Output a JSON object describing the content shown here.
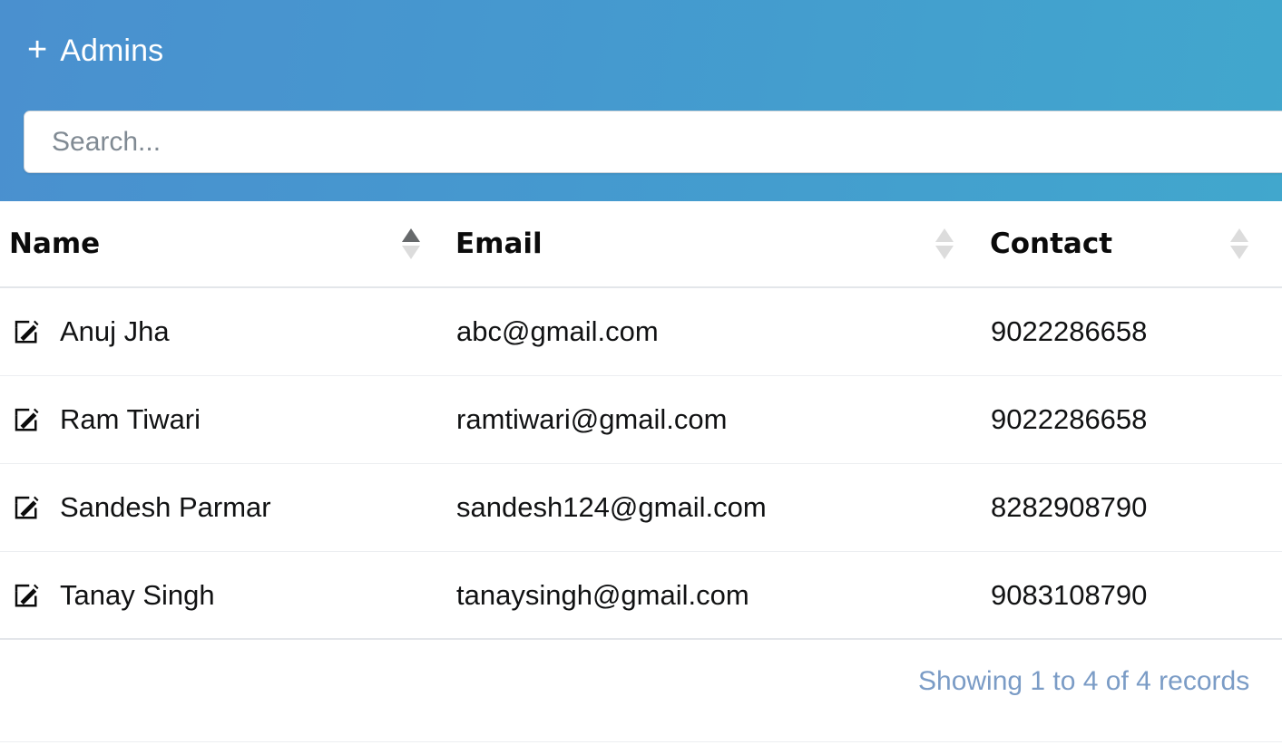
{
  "header": {
    "add_button": {
      "icon": "plus-icon",
      "plus": "+",
      "label": "Admins"
    },
    "search": {
      "placeholder": "Search...",
      "value": ""
    },
    "accent_color_left": "#4a90cf",
    "accent_color_right": "#41a7cd"
  },
  "table": {
    "columns": [
      {
        "key": "name",
        "label": "Name",
        "sort": "asc"
      },
      {
        "key": "email",
        "label": "Email",
        "sort": "none"
      },
      {
        "key": "contact",
        "label": "Contact",
        "sort": "none"
      }
    ],
    "rows": [
      {
        "edit_icon": "edit-pencil-icon",
        "name": "Anuj Jha",
        "email": "abc@gmail.com",
        "contact": "9022286658"
      },
      {
        "edit_icon": "edit-pencil-icon",
        "name": "Ram Tiwari",
        "email": "ramtiwari@gmail.com",
        "contact": "9022286658"
      },
      {
        "edit_icon": "edit-pencil-icon",
        "name": "Sandesh Parmar",
        "email": "sandesh124@gmail.com",
        "contact": "8282908790"
      },
      {
        "edit_icon": "edit-pencil-icon",
        "name": "Tanay Singh",
        "email": "tanaysingh@gmail.com",
        "contact": "9083108790"
      }
    ]
  },
  "footer": {
    "records_info": "Showing 1 to 4 of 4 records",
    "records_info_color": "#7b9cc6"
  }
}
